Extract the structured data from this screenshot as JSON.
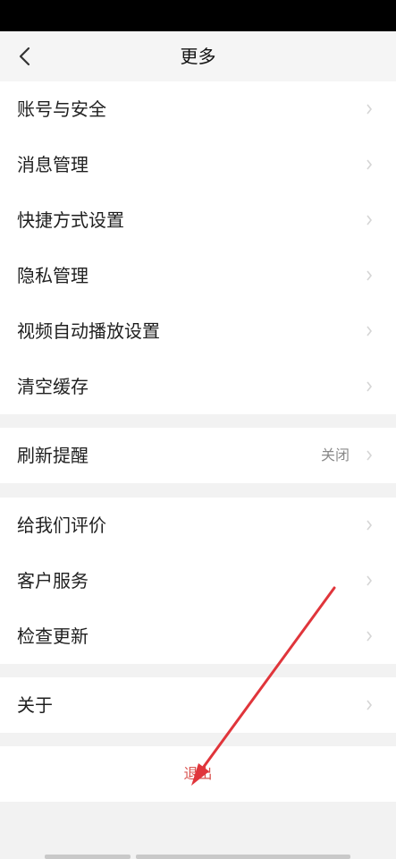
{
  "header": {
    "title": "更多",
    "back_icon": "chevron-left-icon"
  },
  "sections": [
    {
      "items": [
        {
          "label": "账号与安全"
        },
        {
          "label": "消息管理"
        },
        {
          "label": "快捷方式设置"
        },
        {
          "label": "隐私管理"
        },
        {
          "label": "视频自动播放设置"
        },
        {
          "label": "清空缓存"
        }
      ]
    },
    {
      "items": [
        {
          "label": "刷新提醒",
          "value": "关闭"
        }
      ]
    },
    {
      "items": [
        {
          "label": "给我们评价"
        },
        {
          "label": "客户服务"
        },
        {
          "label": "检查更新"
        }
      ]
    },
    {
      "items": [
        {
          "label": "关于"
        }
      ]
    }
  ],
  "logout": {
    "label": "退出"
  },
  "colors": {
    "logout_text": "#d9534f",
    "annotation_arrow": "#e0353b",
    "page_background": "#f2f2f2",
    "row_background": "#ffffff"
  }
}
